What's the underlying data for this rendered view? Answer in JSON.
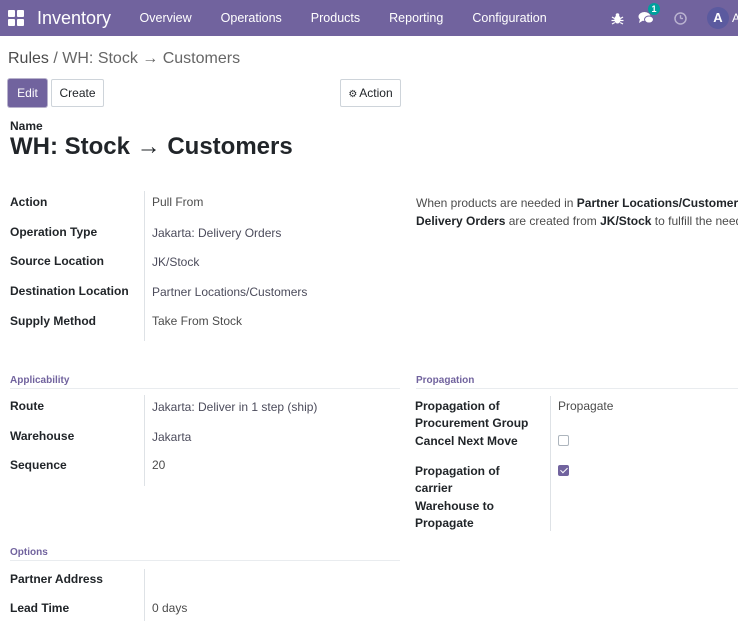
{
  "navbar": {
    "brand": "Inventory",
    "menu": [
      "Overview",
      "Operations",
      "Products",
      "Reporting",
      "Configuration"
    ],
    "chat_badge": "1",
    "avatar_letter": "A",
    "user_name_cut": "A"
  },
  "breadcrumb": {
    "parent": "Rules",
    "separator": "/",
    "current": "WH: Stock → Customers"
  },
  "buttons": {
    "edit": "Edit",
    "create": "Create",
    "action": "Action"
  },
  "form": {
    "name_label": "Name",
    "name": "WH: Stock → Customers",
    "main_fields": [
      {
        "label": "Action",
        "value": "Pull From"
      },
      {
        "label": "Operation Type",
        "value": "Jakarta: Delivery Orders"
      },
      {
        "label": "Source Location",
        "value": "JK/Stock"
      },
      {
        "label": "Destination Location",
        "value": "Partner Locations/Customers"
      },
      {
        "label": "Supply Method",
        "value": "Take From Stock"
      }
    ],
    "help": {
      "line1_pre": "When products are needed in ",
      "line1_bold": "Partner Locations/Customers",
      "line2_bold1": "Delivery Orders",
      "line2_mid": " are created from ",
      "line2_bold2": "JK/Stock",
      "line2_post": " to fulfill the need."
    },
    "applicability": {
      "title": "Applicability",
      "fields": [
        {
          "label": "Route",
          "value": "Jakarta: Deliver in 1 step (ship)"
        },
        {
          "label": "Warehouse",
          "value": "Jakarta"
        },
        {
          "label": "Sequence",
          "value": "20"
        }
      ]
    },
    "propagation": {
      "title": "Propagation",
      "group_label": "Propagation of Procurement Group",
      "group_value": "Propagate",
      "cancel_label": "Cancel Next Move",
      "cancel_checked": false,
      "carrier_label": "Propagation of carrier",
      "carrier_checked": true,
      "warehouse_label": "Warehouse to Propagate"
    },
    "options": {
      "title": "Options",
      "fields": [
        {
          "label": "Partner Address",
          "value": ""
        },
        {
          "label": "Lead Time",
          "value": "0 days"
        }
      ]
    }
  },
  "colors": {
    "brand": "#71639e",
    "badge": "#00a09d"
  }
}
